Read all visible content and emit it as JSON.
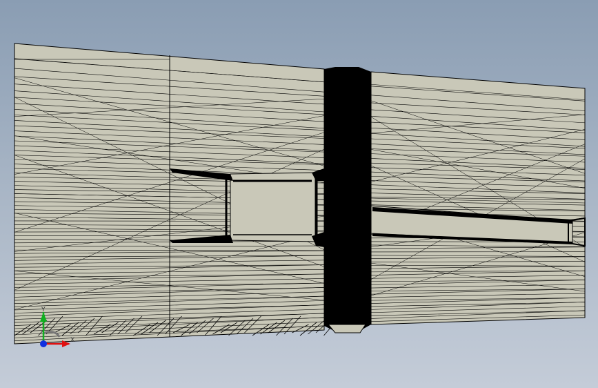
{
  "viewport": {
    "background_top": "#8a9db3",
    "background_bottom": "#c4ccd8"
  },
  "model": {
    "face_color": "#c9c8b8",
    "edge_color": "#000000",
    "shading": "shaded-with-edges"
  },
  "triad": {
    "x_label": "X",
    "y_label": "Y",
    "x_color": "#e01010",
    "y_color": "#10b020",
    "z_color": "#1030e0"
  }
}
